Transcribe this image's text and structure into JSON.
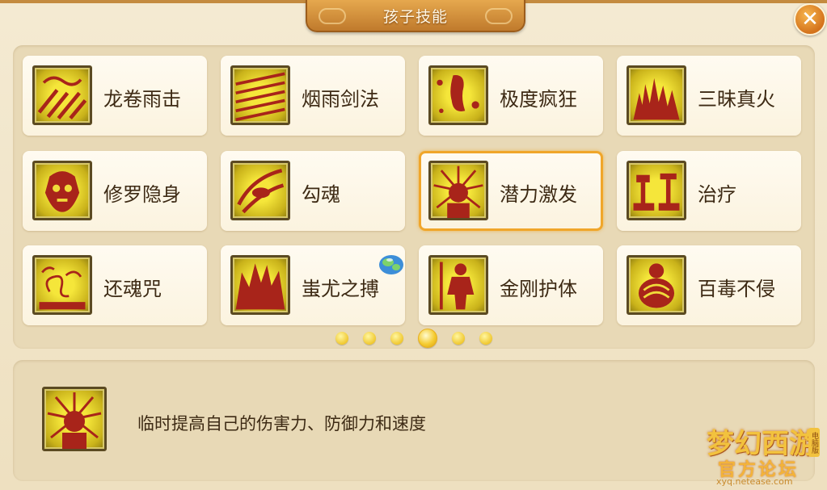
{
  "window": {
    "title": "孩子技能"
  },
  "close_icon": "close-icon",
  "skills": [
    {
      "name": "龙卷雨击",
      "icon": "tornado-rain-icon"
    },
    {
      "name": "烟雨剑法",
      "icon": "misty-sword-icon"
    },
    {
      "name": "极度疯狂",
      "icon": "frenzy-icon"
    },
    {
      "name": "三昧真火",
      "icon": "true-fire-icon"
    },
    {
      "name": "修罗隐身",
      "icon": "asura-stealth-icon"
    },
    {
      "name": "勾魂",
      "icon": "soul-hook-icon"
    },
    {
      "name": "潜力激发",
      "icon": "potential-burst-icon",
      "selected": true
    },
    {
      "name": "治疗",
      "icon": "heal-icon"
    },
    {
      "name": "还魂咒",
      "icon": "revive-curse-icon"
    },
    {
      "name": "蚩尤之搏",
      "icon": "chiyou-strike-icon"
    },
    {
      "name": "金刚护体",
      "icon": "vajra-guard-icon"
    },
    {
      "name": "百毒不侵",
      "icon": "poison-immune-icon"
    }
  ],
  "pagination": {
    "total_pages": 6,
    "current_page": 4
  },
  "description": {
    "icon": "potential-burst-icon",
    "text": "临时提高自己的伤害力、防御力和速度"
  },
  "watermark": {
    "main": "梦幻西游",
    "sub": "官方论坛",
    "url": "xyq.netease.com",
    "tag": "电脑版"
  },
  "colors": {
    "accent": "#f0a62a",
    "title_bar": "#d08a38",
    "text": "#3d2a14"
  }
}
